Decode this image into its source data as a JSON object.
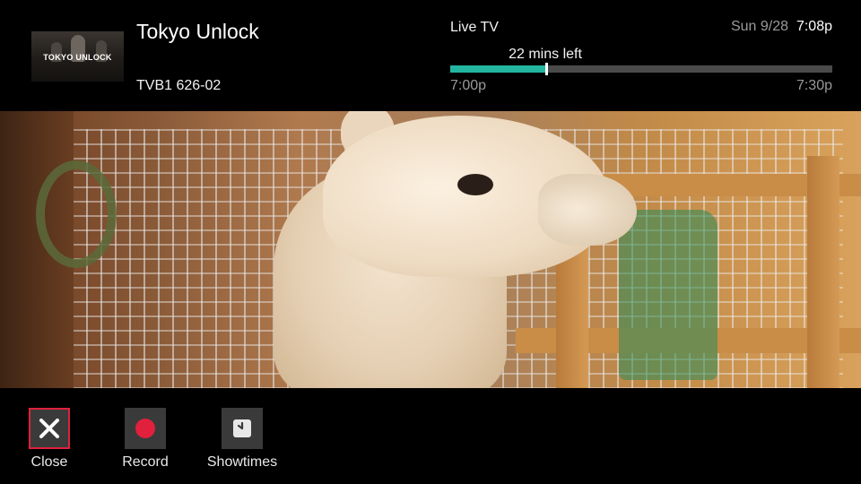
{
  "header": {
    "thumbnail_text": "TOKYO UNLOCK",
    "title": "Tokyo Unlock",
    "channel": "TVB1 626-02",
    "source_label": "Live TV",
    "time_left": "22 mins left",
    "start_time": "7:00p",
    "end_time": "7:30p",
    "progress_fraction": 0.25,
    "date": "Sun 9/28",
    "clock": "7:08p"
  },
  "video": {
    "icon": "alpaca-video-frame"
  },
  "controls": [
    {
      "label": "Close",
      "icon": "close-icon",
      "focused": true
    },
    {
      "label": "Record",
      "icon": "record-icon",
      "focused": false
    },
    {
      "label": "Showtimes",
      "icon": "clock-icon",
      "focused": false
    }
  ],
  "colors": {
    "progress": "#23b5a0",
    "focus_border": "#e0203c",
    "record_dot": "#e0203c"
  }
}
